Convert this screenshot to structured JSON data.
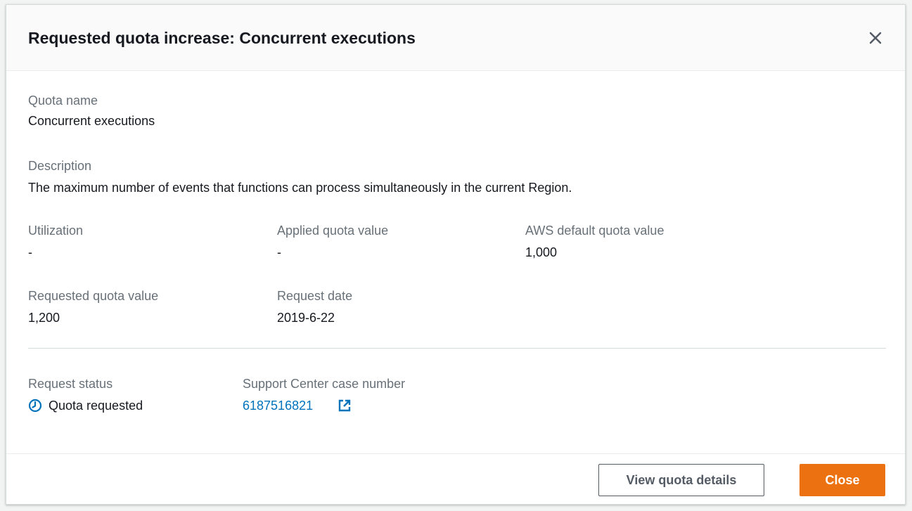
{
  "modal": {
    "title": "Requested quota increase: Concurrent executions",
    "close_icon": "close-icon"
  },
  "fields": {
    "quota_name": {
      "label": "Quota name",
      "value": "Concurrent executions"
    },
    "description": {
      "label": "Description",
      "value": "The maximum number of events that functions can process simultaneously in the current Region."
    },
    "utilization": {
      "label": "Utilization",
      "value": "-"
    },
    "applied_quota_value": {
      "label": "Applied quota value",
      "value": "-"
    },
    "aws_default_quota_value": {
      "label": "AWS default quota value",
      "value": "1,000"
    },
    "requested_quota_value": {
      "label": "Requested quota value",
      "value": "1,200"
    },
    "request_date": {
      "label": "Request date",
      "value": "2019-6-22"
    },
    "request_status": {
      "label": "Request status",
      "value": "Quota requested",
      "icon": "clock-icon"
    },
    "support_case": {
      "label": "Support Center case number",
      "value": "6187516821",
      "icon": "external-link-icon"
    }
  },
  "footer": {
    "view_details_label": "View quota details",
    "close_label": "Close"
  },
  "colors": {
    "primary_button": "#ec7211",
    "link": "#0073bb",
    "label": "#687078",
    "text": "#16191f"
  }
}
